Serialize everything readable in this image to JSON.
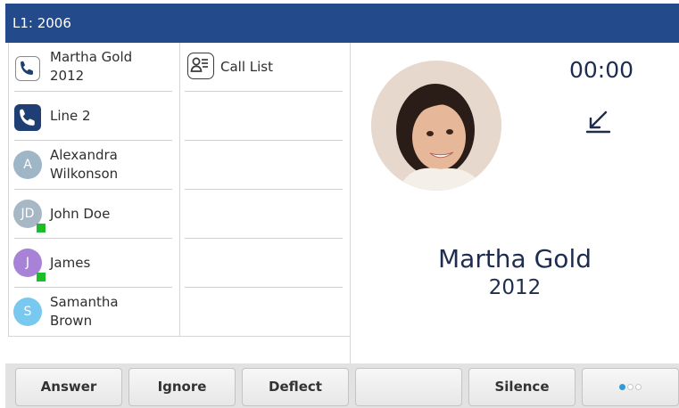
{
  "header": {
    "line_label": "L1: 2006"
  },
  "lines": [
    {
      "type": "call",
      "icon": "phone-outline-icon",
      "label": "Martha Gold\n2012"
    },
    {
      "type": "line",
      "icon": "phone-solid-icon",
      "label": "Line 2"
    },
    {
      "type": "contact",
      "initials": "A",
      "color": "#9fb6c6",
      "label": "Alexandra\nWilkonson",
      "presence": false
    },
    {
      "type": "contact",
      "initials": "JD",
      "color": "#a7b8c4",
      "label": "John Doe",
      "presence": true
    },
    {
      "type": "contact",
      "initials": "J",
      "color": "#a782d6",
      "label": "James",
      "presence": true
    },
    {
      "type": "contact",
      "initials": "S",
      "color": "#78c8ef",
      "label": "Samantha\nBrown",
      "presence": false
    }
  ],
  "call_list": {
    "label": "Call List",
    "icon": "call-list-icon"
  },
  "call": {
    "timer": "00:00",
    "direction_icon": "incoming-arrow-icon",
    "caller_name": "Martha Gold",
    "caller_number": "2012",
    "presence_color": "#1dbd2a"
  },
  "softkeys": [
    {
      "label": "Answer"
    },
    {
      "label": "Ignore"
    },
    {
      "label": "Deflect"
    },
    {
      "label": ""
    },
    {
      "label": "Silence"
    },
    {
      "label": "",
      "page_indicator": {
        "current": 1,
        "total": 3
      }
    }
  ],
  "colors": {
    "header": "#234b8c",
    "accent_dot": "#2b9bd9"
  }
}
